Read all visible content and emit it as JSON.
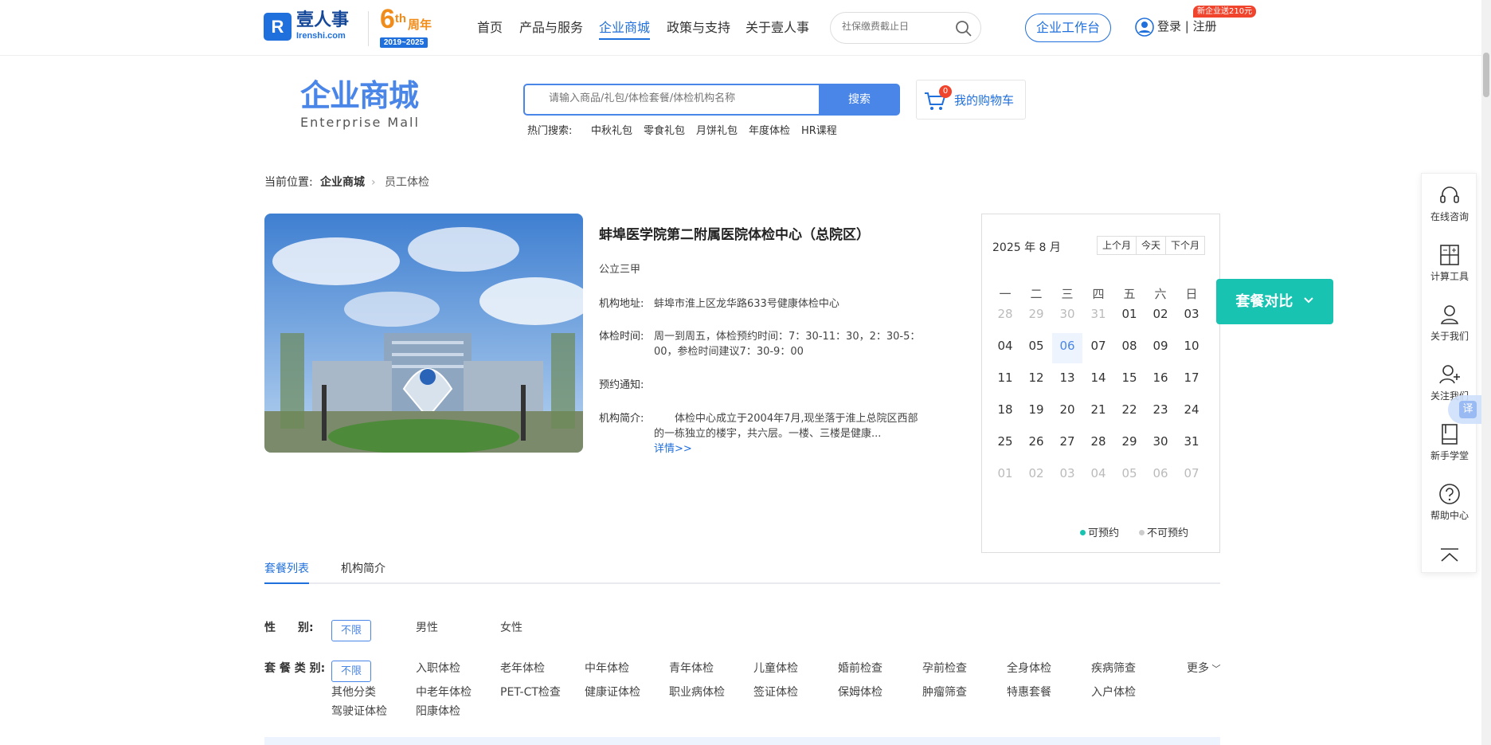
{
  "header": {
    "logo_letter": "R",
    "brand_name": "壹人事",
    "brand_domain": "Irenshi.com",
    "anniversary_num": "6",
    "anniversary_th": "th",
    "anniversary_label": "周年",
    "anniversary_years": "2019~2025",
    "nav": [
      {
        "label": "首页",
        "active": false
      },
      {
        "label": "产品与服务",
        "active": false
      },
      {
        "label": "企业商城",
        "active": true
      },
      {
        "label": "政策与支持",
        "active": false
      },
      {
        "label": "关于壹人事",
        "active": false
      }
    ],
    "search_placeholder": "社保缴费截止日",
    "workbench_label": "企业工作台",
    "login_label": "登录 | 注册",
    "new_badge": "新企业送210元"
  },
  "mall": {
    "title": "企业商城",
    "subtitle": "Enterprise  Mall",
    "search_placeholder": "请输入商品/礼包/体检套餐/体检机构名称",
    "search_button": "搜索",
    "cart_count": "0",
    "cart_label": "我的购物车",
    "hot_label": "热门搜索:",
    "hot_terms": [
      "中秋礼包",
      "零食礼包",
      "月饼礼包",
      "年度体检",
      "HR课程"
    ]
  },
  "breadcrumb": {
    "prefix": "当前位置:",
    "items": [
      "企业商城",
      "员工体检"
    ]
  },
  "institution": {
    "name": "蚌埠医学院第二附属医院体检中心（总院区）",
    "level": "公立三甲",
    "address_label": "机构地址:",
    "address": "蚌埠市淮上区龙华路633号健康体检中心",
    "hours_label": "体检时间:",
    "hours": "周一到周五，体检预约时间：7：30-11：30，2：30-5：00，参检时间建议7：30-9：00",
    "notice_label": "预约通知:",
    "notice": "",
    "intro_label": "机构简介:",
    "intro": "体检中心成立于2004年7月,现坐落于淮上总院区西部的一栋独立的楼宇，共六层。一楼、三楼是健康...",
    "more_link": "详情>>"
  },
  "calendar": {
    "year_month": "2025 年 8 月",
    "buttons": [
      "上个月",
      "今天",
      "下个月"
    ],
    "weekdays": [
      "一",
      "二",
      "三",
      "四",
      "五",
      "六",
      "日"
    ],
    "weeks": [
      [
        {
          "d": "28",
          "m": "prev"
        },
        {
          "d": "29",
          "m": "prev"
        },
        {
          "d": "30",
          "m": "prev"
        },
        {
          "d": "31",
          "m": "prev"
        },
        {
          "d": "01",
          "m": "cur"
        },
        {
          "d": "02",
          "m": "cur"
        },
        {
          "d": "03",
          "m": "cur"
        }
      ],
      [
        {
          "d": "04",
          "m": "cur"
        },
        {
          "d": "05",
          "m": "cur"
        },
        {
          "d": "06",
          "m": "today"
        },
        {
          "d": "07",
          "m": "cur"
        },
        {
          "d": "08",
          "m": "cur"
        },
        {
          "d": "09",
          "m": "cur"
        },
        {
          "d": "10",
          "m": "cur"
        }
      ],
      [
        {
          "d": "11",
          "m": "cur"
        },
        {
          "d": "12",
          "m": "cur"
        },
        {
          "d": "13",
          "m": "cur"
        },
        {
          "d": "14",
          "m": "cur"
        },
        {
          "d": "15",
          "m": "cur"
        },
        {
          "d": "16",
          "m": "cur"
        },
        {
          "d": "17",
          "m": "cur"
        }
      ],
      [
        {
          "d": "18",
          "m": "cur"
        },
        {
          "d": "19",
          "m": "cur"
        },
        {
          "d": "20",
          "m": "cur"
        },
        {
          "d": "21",
          "m": "cur"
        },
        {
          "d": "22",
          "m": "cur"
        },
        {
          "d": "23",
          "m": "cur"
        },
        {
          "d": "24",
          "m": "cur"
        }
      ],
      [
        {
          "d": "25",
          "m": "cur"
        },
        {
          "d": "26",
          "m": "cur"
        },
        {
          "d": "27",
          "m": "cur"
        },
        {
          "d": "28",
          "m": "cur"
        },
        {
          "d": "29",
          "m": "cur"
        },
        {
          "d": "30",
          "m": "cur"
        },
        {
          "d": "31",
          "m": "cur"
        }
      ],
      [
        {
          "d": "01",
          "m": "next"
        },
        {
          "d": "02",
          "m": "next"
        },
        {
          "d": "03",
          "m": "next"
        },
        {
          "d": "04",
          "m": "next"
        },
        {
          "d": "05",
          "m": "next"
        },
        {
          "d": "06",
          "m": "next"
        },
        {
          "d": "07",
          "m": "next"
        }
      ]
    ],
    "legend_available": "可预约",
    "legend_unavailable": "不可预约"
  },
  "compare_button": "套餐对比",
  "tabs": [
    {
      "label": "套餐列表",
      "active": true
    },
    {
      "label": "机构简介",
      "active": false
    }
  ],
  "filters": {
    "gender_label": "性　　别:",
    "gender_selected": "不限",
    "gender_options": [
      "男性",
      "女性"
    ],
    "category_label": "套 餐 类 别:",
    "category_selected": "不限",
    "category_options": [
      "入职体检",
      "老年体检",
      "中年体检",
      "青年体检",
      "儿童体检",
      "婚前检查",
      "孕前检查",
      "全身体检",
      "疾病筛查",
      "其他分类",
      "中老年体检",
      "PET-CT检查",
      "健康证体检",
      "职业病体检",
      "签证体检",
      "保姆体检",
      "肿瘤筛查",
      "特惠套餐",
      "入户体检",
      "驾驶证体检",
      "阳康体检"
    ],
    "more_label": "更多"
  },
  "sidebar": [
    {
      "label": "在线咨询",
      "icon": "headset-icon"
    },
    {
      "label": "计算工具",
      "icon": "calculator-icon"
    },
    {
      "label": "关于我们",
      "icon": "user-icon"
    },
    {
      "label": "关注我们",
      "icon": "user-plus-icon"
    },
    {
      "label": "新手学堂",
      "icon": "book-icon"
    },
    {
      "label": "帮助中心",
      "icon": "help-icon"
    }
  ],
  "translate_label": "译",
  "colors": {
    "brand_blue": "#1f6fdc",
    "accent_blue": "#4a86e8",
    "teal": "#19c3b2",
    "red": "#f0442d",
    "orange": "#f08c1a",
    "muted": "#bbbbbb",
    "available": "#19c3b2",
    "unavailable": "#cccccc"
  }
}
